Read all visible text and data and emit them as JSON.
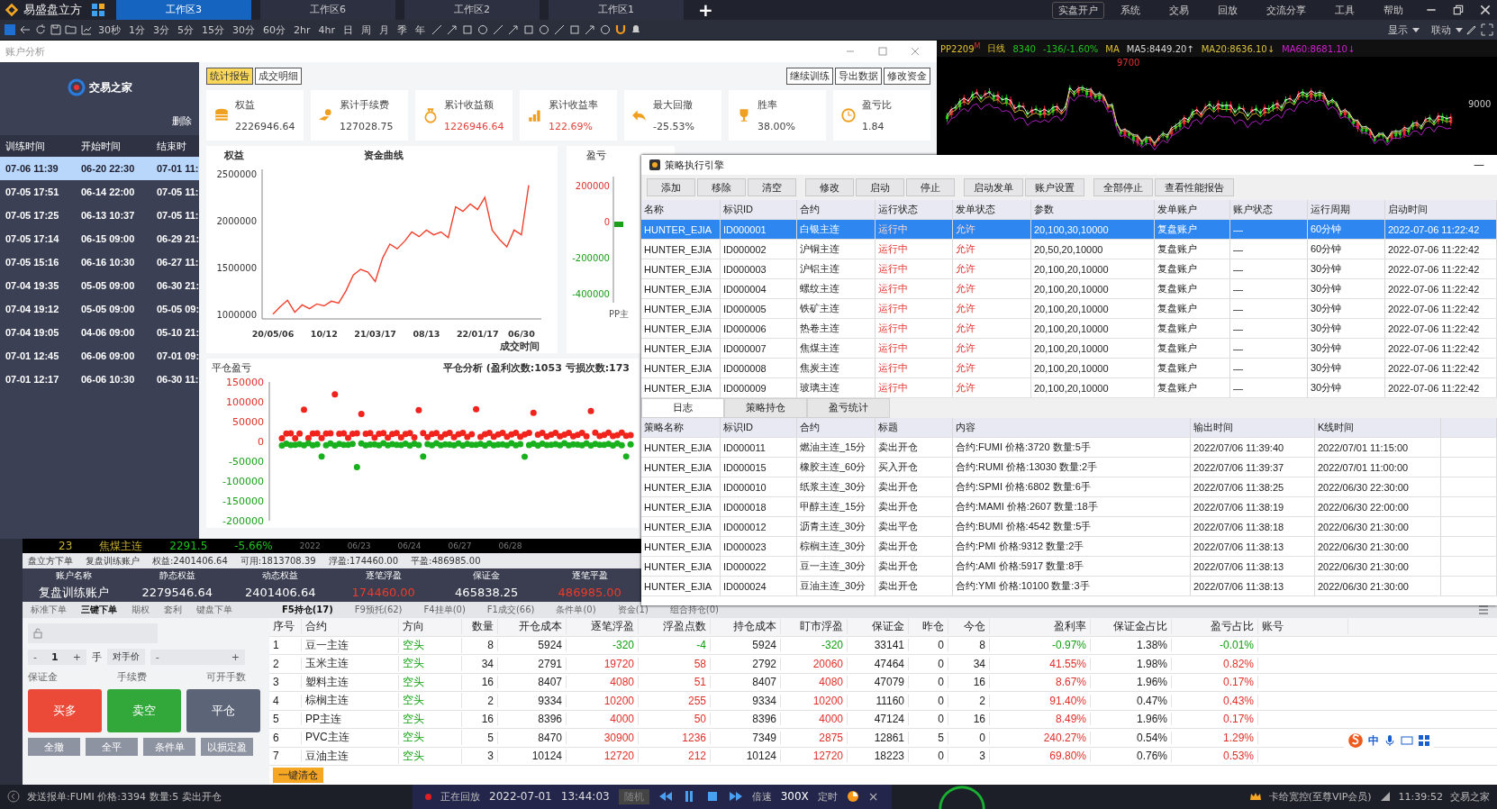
{
  "app": {
    "name": "易盛盘立方",
    "workspaces": [
      {
        "label": "工作区3",
        "selected": true
      },
      {
        "label": "工作区6",
        "selected": false
      },
      {
        "label": "工作区2",
        "selected": false
      },
      {
        "label": "工作区1",
        "selected": false
      }
    ],
    "add": "+",
    "menu": [
      {
        "label": "实盘开户",
        "selected": true
      },
      {
        "label": "系统",
        "selected": false
      },
      {
        "label": "交易",
        "selected": false
      },
      {
        "label": "回放",
        "selected": false
      },
      {
        "label": "交流分享",
        "selected": false
      },
      {
        "label": "工具",
        "selected": false
      },
      {
        "label": "帮助",
        "selected": false
      }
    ]
  },
  "toolbar": {
    "periods": [
      "30秒",
      "1分",
      "3分",
      "5分",
      "15分",
      "30分",
      "60分",
      "2hr",
      "4hr",
      "日",
      "周",
      "月",
      "季",
      "年"
    ],
    "display": "显示",
    "link": "联动"
  },
  "analysis": {
    "title": "账户分析",
    "logo": "交易之家",
    "delete": "删除",
    "columns": [
      "训练时间",
      "开始时间",
      "结束时"
    ],
    "sessions": [
      {
        "cells": [
          "07-06 11:39",
          "06-20 22:30",
          "07-01 11:"
        ],
        "selected": true
      },
      {
        "cells": [
          "07-05 17:51",
          "06-14 22:00",
          "07-05 11:"
        ],
        "selected": false
      },
      {
        "cells": [
          "07-05 17:25",
          "06-13 10:37",
          "07-05 11:"
        ],
        "selected": false
      },
      {
        "cells": [
          "07-05 17:14",
          "06-15 09:00",
          "06-29 21:"
        ],
        "selected": false
      },
      {
        "cells": [
          "07-05 15:16",
          "06-16 10:30",
          "06-27 11:"
        ],
        "selected": false
      },
      {
        "cells": [
          "07-04 19:35",
          "05-05 09:00",
          "06-30 21:"
        ],
        "selected": false
      },
      {
        "cells": [
          "07-04 19:12",
          "05-05 09:00",
          "05-05 09:"
        ],
        "selected": false
      },
      {
        "cells": [
          "07-04 19:05",
          "04-06 09:00",
          "05-10 21:"
        ],
        "selected": false
      },
      {
        "cells": [
          "07-01 12:45",
          "06-06 09:00",
          "07-01 09:"
        ],
        "selected": false
      },
      {
        "cells": [
          "07-01 12:17",
          "06-06 10:30",
          "06-30 11:"
        ],
        "selected": false
      }
    ],
    "tabs": [
      {
        "label": "统计报告",
        "selected": true
      },
      {
        "label": "成交明细",
        "selected": false
      }
    ],
    "actions": [
      "继续训练",
      "导出数据",
      "修改资金"
    ],
    "stats": [
      {
        "label": "权益",
        "value": "2226946.64",
        "color": "#444444"
      },
      {
        "label": "累计手续费",
        "value": "127028.75",
        "color": "#444444"
      },
      {
        "label": "累计收益额",
        "value": "1226946.64",
        "color": "#e0433a"
      },
      {
        "label": "累计收益率",
        "value": "122.69%",
        "color": "#e0433a"
      },
      {
        "label": "最大回撤",
        "value": "-25.53%",
        "color": "#444444"
      },
      {
        "label": "胜率",
        "value": "38.00%",
        "color": "#444444"
      },
      {
        "label": "盈亏比",
        "value": "1.84",
        "color": "#444444"
      }
    ],
    "equity": {
      "chart_data": {
        "type": "line",
        "title": "资金曲线",
        "ylabel": "权益",
        "xlabel": "成交时间",
        "categories": [
          "20/05/06",
          null,
          null,
          null,
          null,
          null,
          null,
          "10/12",
          null,
          null,
          null,
          null,
          null,
          null,
          "21/03/17",
          null,
          null,
          null,
          null,
          null,
          null,
          "08/13",
          null,
          null,
          null,
          null,
          null,
          null,
          "22/01/17",
          null,
          null,
          null,
          null,
          null,
          "06/30",
          null
        ],
        "series": [
          {
            "color": "#f0402e",
            "values": [
              1000000,
              1080000,
              1150000,
              1020000,
              1100000,
              1060000,
              1110000,
              1090000,
              1140000,
              1120000,
              1250000,
              1420000,
              1480000,
              1450000,
              1350000,
              1600000,
              1750000,
              1700000,
              1780000,
              1880000,
              1830000,
              1900000,
              1850000,
              1880000,
              1820000,
              2150000,
              2100000,
              2180000,
              2120000,
              2250000,
              1900000,
              1800000,
              1720000,
              1900000,
              1850000,
              2380000
            ]
          }
        ],
        "ylim": [
          950000,
          2550000
        ],
        "yticks": [
          1000000,
          1500000,
          2000000,
          2500000
        ]
      }
    },
    "pnl": {
      "chart_data": {
        "type": "bar",
        "ylabel": "盈亏",
        "categories": [
          "PP主"
        ],
        "values": [
          -30000
        ],
        "ylim": [
          -450000,
          250000
        ],
        "yticks": [
          200000,
          0,
          -200000,
          -400000
        ]
      }
    },
    "scatter": {
      "title": "平仓分析 (盈利次数:1053 亏损次数:173",
      "ylabel": "平仓盈亏",
      "yticks": [
        {
          "label": "150000",
          "color": "#e0302a"
        },
        {
          "label": "100000",
          "color": "#e0302a"
        },
        {
          "label": "50000",
          "color": "#e0302a"
        },
        {
          "label": "0",
          "color": "#e0302a"
        },
        {
          "label": "-50000",
          "color": "#18a018"
        },
        {
          "label": "-100000",
          "color": "#18a018"
        },
        {
          "label": "-150000",
          "color": "#18a018"
        },
        {
          "label": "-200000",
          "color": "#18a018"
        }
      ]
    }
  },
  "kline": {
    "symbol": "PP2209",
    "mark": "M",
    "period": "日线",
    "price": "8340",
    "change": "-136/-1.60%",
    "ma": "MA",
    "ma_values": [
      {
        "text": "MA5:8449.20↑",
        "color": "#d8d8d8"
      },
      {
        "text": "MA20:8636.10↓",
        "color": "#d8c040"
      },
      {
        "text": "MA60:8681.10↓",
        "color": "#d020d0"
      }
    ],
    "high": "9700",
    "axis": "9000"
  },
  "engine": {
    "title": "策略执行引擎",
    "minimize": "—",
    "buttons": [
      [
        "添加",
        "移除",
        "清空"
      ],
      [
        "修改",
        "启动",
        "停止"
      ],
      [
        "启动发单",
        "账户设置"
      ],
      [
        "全部停止",
        "查看性能报告"
      ]
    ],
    "columns": [
      {
        "label": "名称",
        "kind": "text"
      },
      {
        "label": "标识ID",
        "kind": "text"
      },
      {
        "label": "合约",
        "kind": "text"
      },
      {
        "label": "运行状态",
        "kind": "status"
      },
      {
        "label": "发单状态",
        "kind": "status"
      },
      {
        "label": "参数",
        "kind": "text"
      },
      {
        "label": "发单账户",
        "kind": "text"
      },
      {
        "label": "账户状态",
        "kind": "text"
      },
      {
        "label": "运行周期",
        "kind": "text"
      },
      {
        "label": "启动时间",
        "kind": "text"
      }
    ],
    "rows": [
      {
        "selected": true,
        "cells": [
          "HUNTER_EJIA",
          "ID000001",
          "白银主连",
          "运行中",
          "允许",
          "20,100,30,10000",
          "复盘账户",
          "—",
          "60分钟",
          "2022-07-06 11:22:42"
        ]
      },
      {
        "selected": false,
        "cells": [
          "HUNTER_EJIA",
          "ID000002",
          "沪铜主连",
          "运行中",
          "允许",
          "20,50,20,10000",
          "复盘账户",
          "—",
          "60分钟",
          "2022-07-06 11:22:42"
        ]
      },
      {
        "selected": false,
        "cells": [
          "HUNTER_EJIA",
          "ID000003",
          "沪铝主连",
          "运行中",
          "允许",
          "20,100,20,10000",
          "复盘账户",
          "—",
          "30分钟",
          "2022-07-06 11:22:42"
        ]
      },
      {
        "selected": false,
        "cells": [
          "HUNTER_EJIA",
          "ID000004",
          "螺纹主连",
          "运行中",
          "允许",
          "20,100,20,10000",
          "复盘账户",
          "—",
          "30分钟",
          "2022-07-06 11:22:42"
        ]
      },
      {
        "selected": false,
        "cells": [
          "HUNTER_EJIA",
          "ID000005",
          "铁矿主连",
          "运行中",
          "允许",
          "20,100,20,10000",
          "复盘账户",
          "—",
          "30分钟",
          "2022-07-06 11:22:42"
        ]
      },
      {
        "selected": false,
        "cells": [
          "HUNTER_EJIA",
          "ID000006",
          "热卷主连",
          "运行中",
          "允许",
          "20,100,20,10000",
          "复盘账户",
          "—",
          "30分钟",
          "2022-07-06 11:22:42"
        ]
      },
      {
        "selected": false,
        "cells": [
          "HUNTER_EJIA",
          "ID000007",
          "焦煤主连",
          "运行中",
          "允许",
          "20,100,20,10000",
          "复盘账户",
          "—",
          "30分钟",
          "2022-07-06 11:22:42"
        ]
      },
      {
        "selected": false,
        "cells": [
          "HUNTER_EJIA",
          "ID000008",
          "焦炭主连",
          "运行中",
          "允许",
          "20,100,20,10000",
          "复盘账户",
          "—",
          "30分钟",
          "2022-07-06 11:22:42"
        ]
      },
      {
        "selected": false,
        "cells": [
          "HUNTER_EJIA",
          "ID000009",
          "玻璃主连",
          "运行中",
          "允许",
          "20,100,20,10000",
          "复盘账户",
          "—",
          "30分钟",
          "2022-07-06 11:22:42"
        ]
      }
    ],
    "log_tabs": [
      {
        "label": "日志",
        "selected": true
      },
      {
        "label": "策略持仓",
        "selected": false
      },
      {
        "label": "盈亏统计",
        "selected": false
      }
    ],
    "log_columns": [
      "策略名称",
      "标识ID",
      "合约",
      "标题",
      "内容",
      "输出时间",
      "K线时间"
    ],
    "log_rows": [
      [
        "HUNTER_EJIA",
        "ID000011",
        "燃油主连_15分",
        "卖出开仓",
        "合约:FUMI  价格:3720 数量:5手",
        "2022/07/06 11:39:40",
        "2022/07/01 11:15:00"
      ],
      [
        "HUNTER_EJIA",
        "ID000015",
        "橡胶主连_60分",
        "买入开仓",
        "合约:RUMI  价格:13030 数量:2手",
        "2022/07/06 11:39:37",
        "2022/07/01 11:00:00"
      ],
      [
        "HUNTER_EJIA",
        "ID000010",
        "纸浆主连_30分",
        "卖出开仓",
        "合约:SPMI  价格:6802 数量:6手",
        "2022/07/06 11:38:25",
        "2022/06/30 22:30:00"
      ],
      [
        "HUNTER_EJIA",
        "ID000018",
        "甲醇主连_15分",
        "卖出开仓",
        "合约:MAMI  价格:2607 数量:18手",
        "2022/07/06 11:38:19",
        "2022/06/30 22:00:00"
      ],
      [
        "HUNTER_EJIA",
        "ID000012",
        "沥青主连_30分",
        "卖出平仓",
        "合约:BUMI  价格:4542 数量:5手",
        "2022/07/06 11:38:18",
        "2022/06/30 21:30:00"
      ],
      [
        "HUNTER_EJIA",
        "ID000023",
        "棕榈主连_30分",
        "卖出开仓",
        "合约:PMI  价格:9312 数量:2手",
        "2022/07/06 11:38:13",
        "2022/06/30 21:30:00"
      ],
      [
        "HUNTER_EJIA",
        "ID000022",
        "豆一主连_30分",
        "卖出开仓",
        "合约:AMI  价格:5917 数量:8手",
        "2022/07/06 11:38:13",
        "2022/06/30 21:30:00"
      ],
      [
        "HUNTER_EJIA",
        "ID000024",
        "豆油主连_30分",
        "卖出开仓",
        "合约:YMI  价格:10100 数量:3手",
        "2022/07/06 11:38:13",
        "2022/06/30 21:30:00"
      ]
    ]
  },
  "ticker": {
    "code": "23",
    "name": "焦煤主连",
    "price": "2291.5",
    "change": "-5.66%",
    "dates": [
      "2022",
      "06/23",
      "06/24",
      "06/27",
      "06/28"
    ]
  },
  "account_bar": [
    "盘立方下单",
    "复盘训练账户",
    "权益:2401406.64",
    "可用:1813708.39",
    "浮盈:174460.00",
    "平盈:486985.00"
  ],
  "account": {
    "columns": [
      "账户名称",
      "静态权益",
      "动态权益",
      "逐笔浮盈",
      "保证金",
      "逐笔平盈"
    ],
    "values": [
      {
        "text": "复盘训练账户",
        "color": "#ffffff"
      },
      {
        "text": "2279546.64",
        "color": "#ffffff"
      },
      {
        "text": "2401406.64",
        "color": "#ffffff"
      },
      {
        "text": "174460.00",
        "color": "#f03a2a"
      },
      {
        "text": "465838.25",
        "color": "#ffffff"
      },
      {
        "text": "486985.00",
        "color": "#f03a2a"
      }
    ]
  },
  "order": {
    "tabs": [
      {
        "label": "标准下单",
        "selected": false
      },
      {
        "label": "三键下单",
        "selected": true
      },
      {
        "label": "期权",
        "selected": false
      },
      {
        "label": "套利",
        "selected": false
      },
      {
        "label": "键盘下单",
        "selected": false
      }
    ],
    "minus": "-",
    "qty": "1",
    "plus": "+",
    "unit": "手",
    "price_type": "对手价",
    "labels": [
      "保证金",
      "手续费",
      "可开手数"
    ],
    "buttons": [
      {
        "label": "买多",
        "kind": "buy"
      },
      {
        "label": "卖空",
        "kind": "sell"
      },
      {
        "label": "平仓",
        "kind": "close"
      }
    ],
    "small_buttons": [
      "全撤",
      "全平",
      "条件单",
      "以损定盈"
    ],
    "clear_all": "一键清仓"
  },
  "positions": {
    "tabs": [
      {
        "label": "F5持仓(17)",
        "selected": true
      },
      {
        "label": "F9预托(62)",
        "selected": false
      },
      {
        "label": "F4挂单(0)",
        "selected": false
      },
      {
        "label": "F1成交(66)",
        "selected": false
      },
      {
        "label": "条件单(0)",
        "selected": false
      },
      {
        "label": "资金(1)",
        "selected": false
      },
      {
        "label": "组合持仓(0)",
        "selected": false
      }
    ],
    "columns": [
      {
        "label": "序号",
        "kind": "text"
      },
      {
        "label": "合约",
        "kind": "text"
      },
      {
        "label": "方向",
        "kind": "side"
      },
      {
        "label": "数量",
        "kind": "num"
      },
      {
        "label": "开仓成本",
        "kind": "num"
      },
      {
        "label": "逐笔浮盈",
        "kind": "pnl"
      },
      {
        "label": "浮盈点数",
        "kind": "pnl"
      },
      {
        "label": "持仓成本",
        "kind": "num"
      },
      {
        "label": "盯市浮盈",
        "kind": "pnl"
      },
      {
        "label": "保证金",
        "kind": "num"
      },
      {
        "label": "昨仓",
        "kind": "num"
      },
      {
        "label": "今仓",
        "kind": "num"
      },
      {
        "label": "盈利率",
        "kind": "pnl"
      },
      {
        "label": "保证金占比",
        "kind": "num"
      },
      {
        "label": "盈亏占比",
        "kind": "pnl"
      },
      {
        "label": "账号",
        "kind": "text"
      }
    ],
    "rows": [
      [
        "1",
        "豆一主连",
        "空头",
        "8",
        "5924",
        "-320",
        "-4",
        "5924",
        "-320",
        "33141",
        "0",
        "8",
        "-0.97%",
        "1.38%",
        "-0.01%"
      ],
      [
        "2",
        "玉米主连",
        "空头",
        "34",
        "2791",
        "19720",
        "58",
        "2792",
        "20060",
        "47464",
        "0",
        "34",
        "41.55%",
        "1.98%",
        "0.82%"
      ],
      [
        "3",
        "塑料主连",
        "空头",
        "16",
        "8407",
        "4080",
        "51",
        "8407",
        "4080",
        "47079",
        "0",
        "16",
        "8.67%",
        "1.96%",
        "0.17%"
      ],
      [
        "4",
        "棕榈主连",
        "空头",
        "2",
        "9334",
        "10200",
        "255",
        "9334",
        "10200",
        "11160",
        "0",
        "2",
        "91.40%",
        "0.47%",
        "0.43%"
      ],
      [
        "5",
        "PP主连",
        "空头",
        "16",
        "8396",
        "4000",
        "50",
        "8396",
        "4000",
        "47124",
        "0",
        "16",
        "8.49%",
        "1.96%",
        "0.17%"
      ],
      [
        "6",
        "PVC主连",
        "空头",
        "5",
        "8470",
        "30900",
        "1236",
        "7349",
        "2875",
        "12861",
        "5",
        "0",
        "240.27%",
        "0.54%",
        "1.29%"
      ],
      [
        "7",
        "豆油主连",
        "空头",
        "3",
        "10124",
        "12720",
        "212",
        "10124",
        "12720",
        "18223",
        "0",
        "3",
        "69.80%",
        "0.76%",
        "0.53%"
      ]
    ]
  },
  "status": {
    "message": "发送报单:FUMI 价格:3394 数量:5 卖出开仓",
    "replay": "正在回放",
    "date": "2022-07-01",
    "time": "13:44:03",
    "random": "随机",
    "speed_label": "倍速",
    "speed": "300X",
    "timer": "定时",
    "close": "×",
    "ime": "中",
    "vip": "卡给宽控(至尊VIP会员)",
    "clock": "11:39:52",
    "brand": "交易之家"
  }
}
